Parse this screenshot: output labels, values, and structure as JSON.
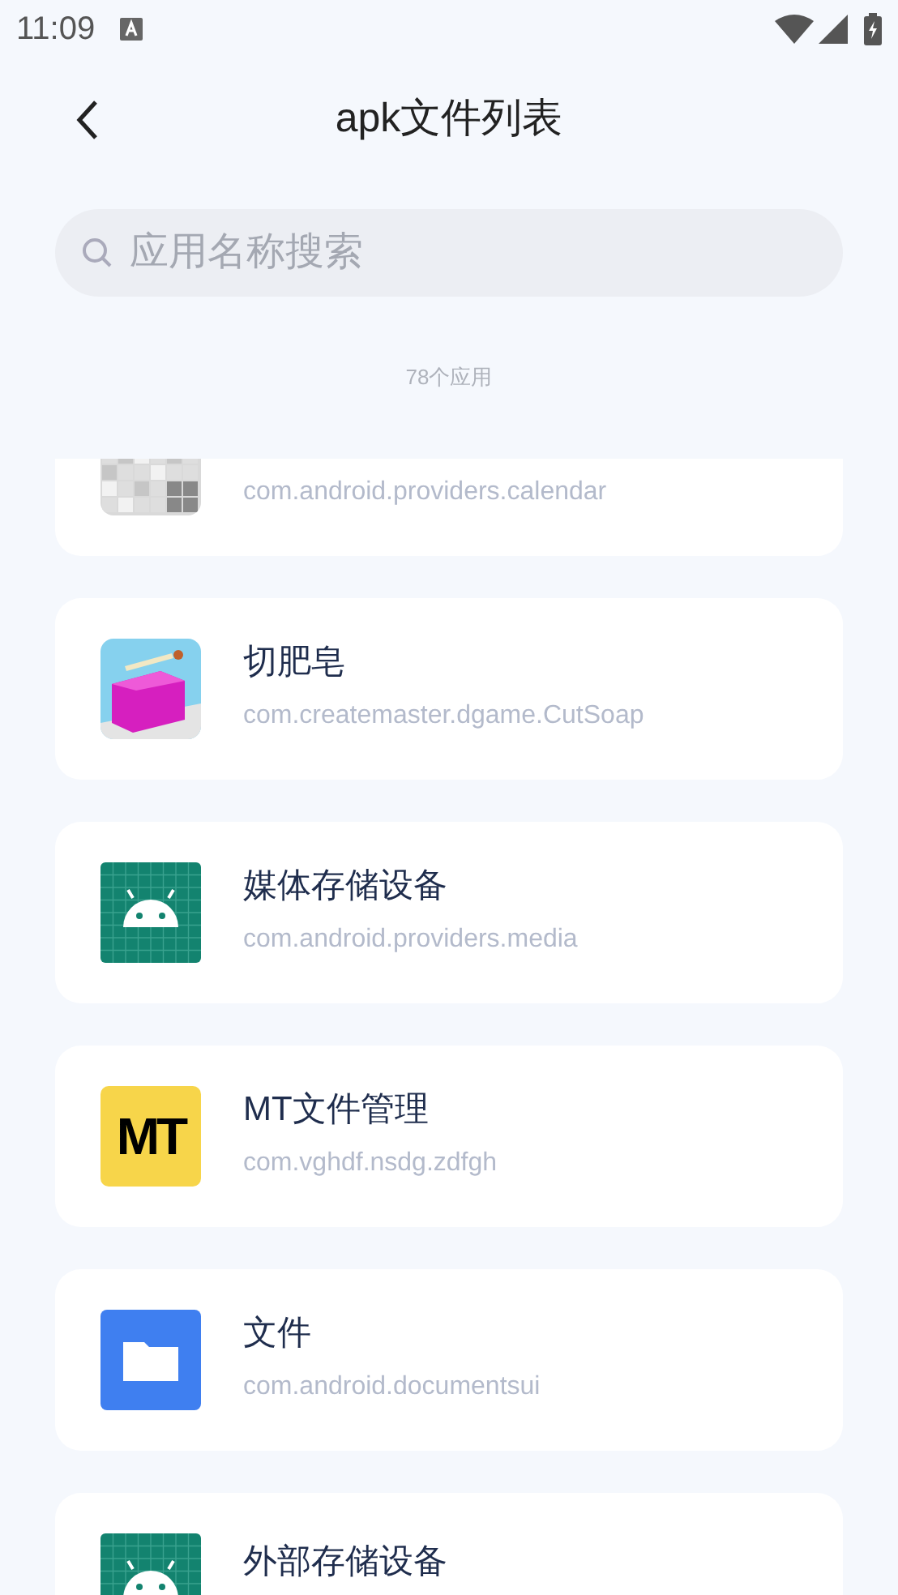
{
  "status_bar": {
    "time": "11:09"
  },
  "header": {
    "title": "apk文件列表"
  },
  "search": {
    "placeholder": "应用名称搜索"
  },
  "count": "78个应用",
  "apps": [
    {
      "icon": {
        "kind": "tiles"
      },
      "package": "com.android.providers.calendar"
    },
    {
      "name": "切肥皂",
      "package": "com.createmaster.dgame.CutSoap"
    },
    {
      "icon": {
        "kind": "android"
      },
      "name": "媒体存储设备",
      "package": "com.android.providers.media"
    },
    {
      "icon": {
        "kind": "logo",
        "text": "MT"
      },
      "name": "MT文件管理",
      "package": "com.vghdf.nsdg.zdfgh"
    },
    {
      "icon": {
        "kind": "folder"
      },
      "name": "文件",
      "package": "com.android.documentsui"
    },
    {
      "icon": {
        "kind": "android"
      },
      "name": "外部存储设备"
    }
  ]
}
